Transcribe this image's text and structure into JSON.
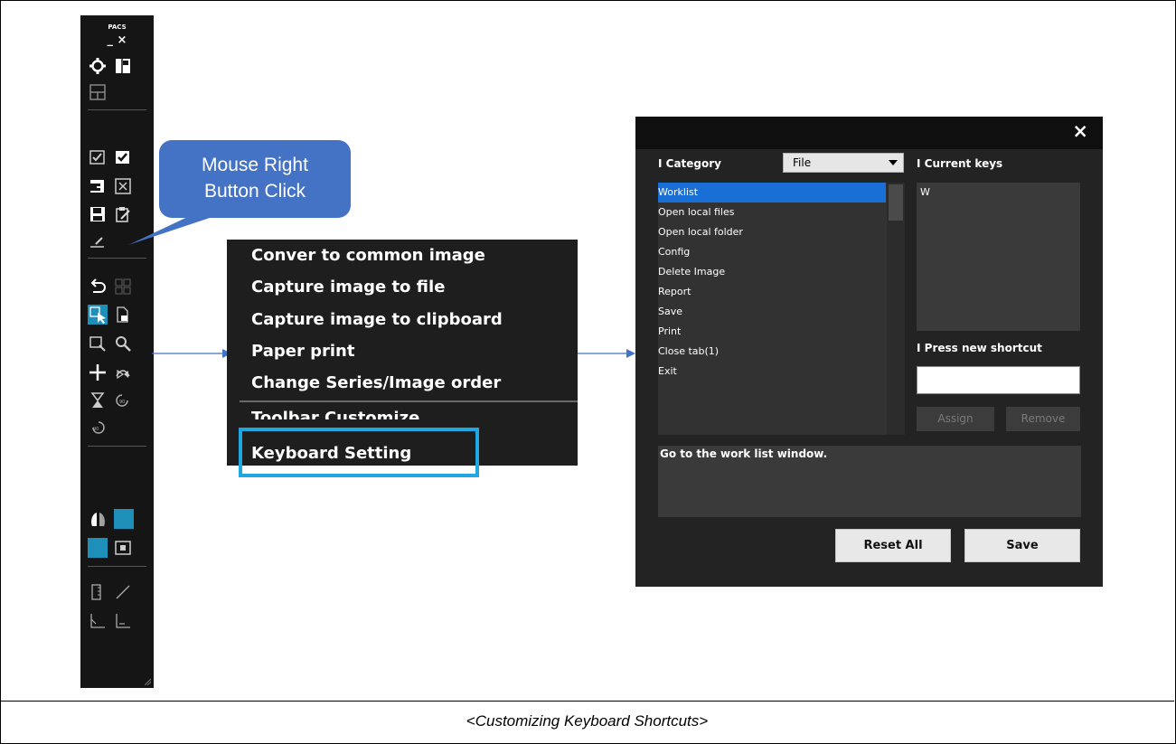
{
  "toolbar": {
    "title": "PACS",
    "window_controls": "_ ×"
  },
  "callout": {
    "line1": "Mouse Right",
    "line2": "Button Click"
  },
  "context_menu": {
    "items": [
      "Conver to common image",
      "Capture image to file",
      "Capture image to clipboard",
      "Paper print",
      "Change Series/Image order"
    ],
    "partial_item": "Toolbar Customize",
    "highlighted_item": "Keyboard Setting"
  },
  "dialog": {
    "close": "×",
    "category_label": "I Category",
    "category_selected": "File",
    "current_keys_label": "I Current keys",
    "current_keys_value": "W",
    "press_new_label": "I Press new shortcut",
    "new_shortcut_value": "",
    "commands": [
      "Worklist",
      "Open local files",
      "Open local folder",
      "Config",
      "Delete Image",
      "Report",
      "Save",
      "Print",
      "Close tab(1)",
      "Exit"
    ],
    "selected_index": 0,
    "assign_label": "Assign",
    "remove_label": "Remove",
    "description": "Go to the work list window.",
    "reset_all_label": "Reset All",
    "save_label": "Save"
  },
  "caption": "<Customizing Keyboard Shortcuts>",
  "colors": {
    "highlight_border": "#1EA7E0",
    "callout_fill": "#4472C4",
    "arrow": "#4472C4",
    "list_selection": "#1a6fd6",
    "toolbar_active": "#1d8fb8"
  }
}
